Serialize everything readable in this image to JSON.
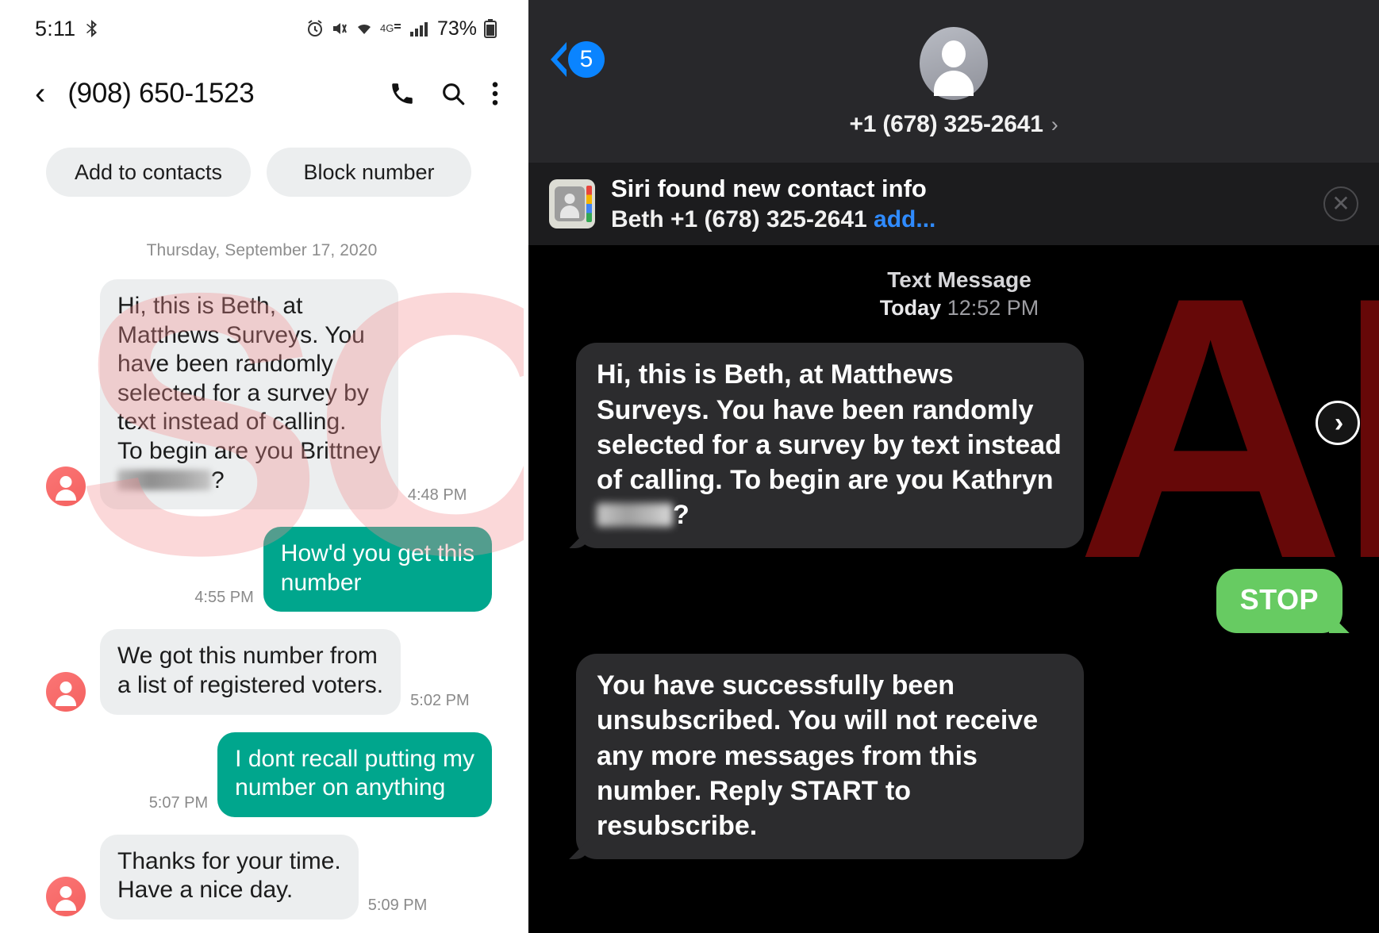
{
  "watermark": {
    "left_text": "SC",
    "right_text": "AM",
    "full": "SCAM",
    "left_color": "#f48c91",
    "right_color": "#aa0e0e"
  },
  "android": {
    "status_bar": {
      "clock": "5:11",
      "battery_percent": "73%",
      "icons": [
        "bluetooth-audio-icon",
        "alarm-icon",
        "mute-vibrate-icon",
        "wifi-icon",
        "4g-lte-icon",
        "signal-icon",
        "battery-icon"
      ]
    },
    "header": {
      "back_icon": "back-chevron-icon",
      "title": "(908) 650-1523",
      "call_icon": "phone-icon",
      "search_icon": "search-icon",
      "menu_icon": "overflow-menu-icon"
    },
    "chips": [
      {
        "label": "Add to contacts"
      },
      {
        "label": "Block number"
      }
    ],
    "date_separator": "Thursday, September 17, 2020",
    "messages": [
      {
        "dir": "in",
        "text": "Hi, this is Beth, at\nMatthews Surveys. You\nhave been randomly\nselected for a survey by\ntext instead of calling.\nTo begin are you Brittney",
        "redacted_suffix": "?",
        "time": "4:48 PM"
      },
      {
        "dir": "out",
        "text": "How'd you get this\nnumber",
        "time": "4:55 PM"
      },
      {
        "dir": "in",
        "text": "We got this number from\na list of registered voters.",
        "time": "5:02 PM"
      },
      {
        "dir": "out",
        "text": "I dont recall putting my\nnumber on anything",
        "time": "5:07 PM"
      },
      {
        "dir": "in",
        "text": "Thanks for your time.\nHave a nice day.",
        "time": "5:09 PM"
      }
    ]
  },
  "ios": {
    "nav": {
      "back_icon": "back-chevron-icon",
      "unread_badge": "5",
      "avatar_icon": "contact-avatar-icon",
      "contact_number": "+1 (678) 325-2641",
      "disclosure_icon": "chevron-right-icon"
    },
    "siri_banner": {
      "app_icon": "contacts-app-icon",
      "title": "Siri found new contact info",
      "subtitle": "Beth +1 (678) 325-2641",
      "action_label": "add...",
      "close_icon": "close-circle-icon"
    },
    "thread_meta": {
      "label": "Text Message",
      "day": "Today",
      "time": "12:52 PM"
    },
    "messages": [
      {
        "dir": "in",
        "text": "Hi, this is Beth, at Matthews Surveys. You have been randomly selected for a survey by text instead of calling. To begin are you Kathryn",
        "redacted_suffix": "?"
      },
      {
        "dir": "out",
        "text": "STOP"
      },
      {
        "dir": "in",
        "text": "You have successfully been unsubscribed. You will not receive any more messages from this number. Reply START to resubscribe."
      }
    ]
  },
  "next_button": {
    "icon": "chevron-right-icon",
    "label": ""
  }
}
